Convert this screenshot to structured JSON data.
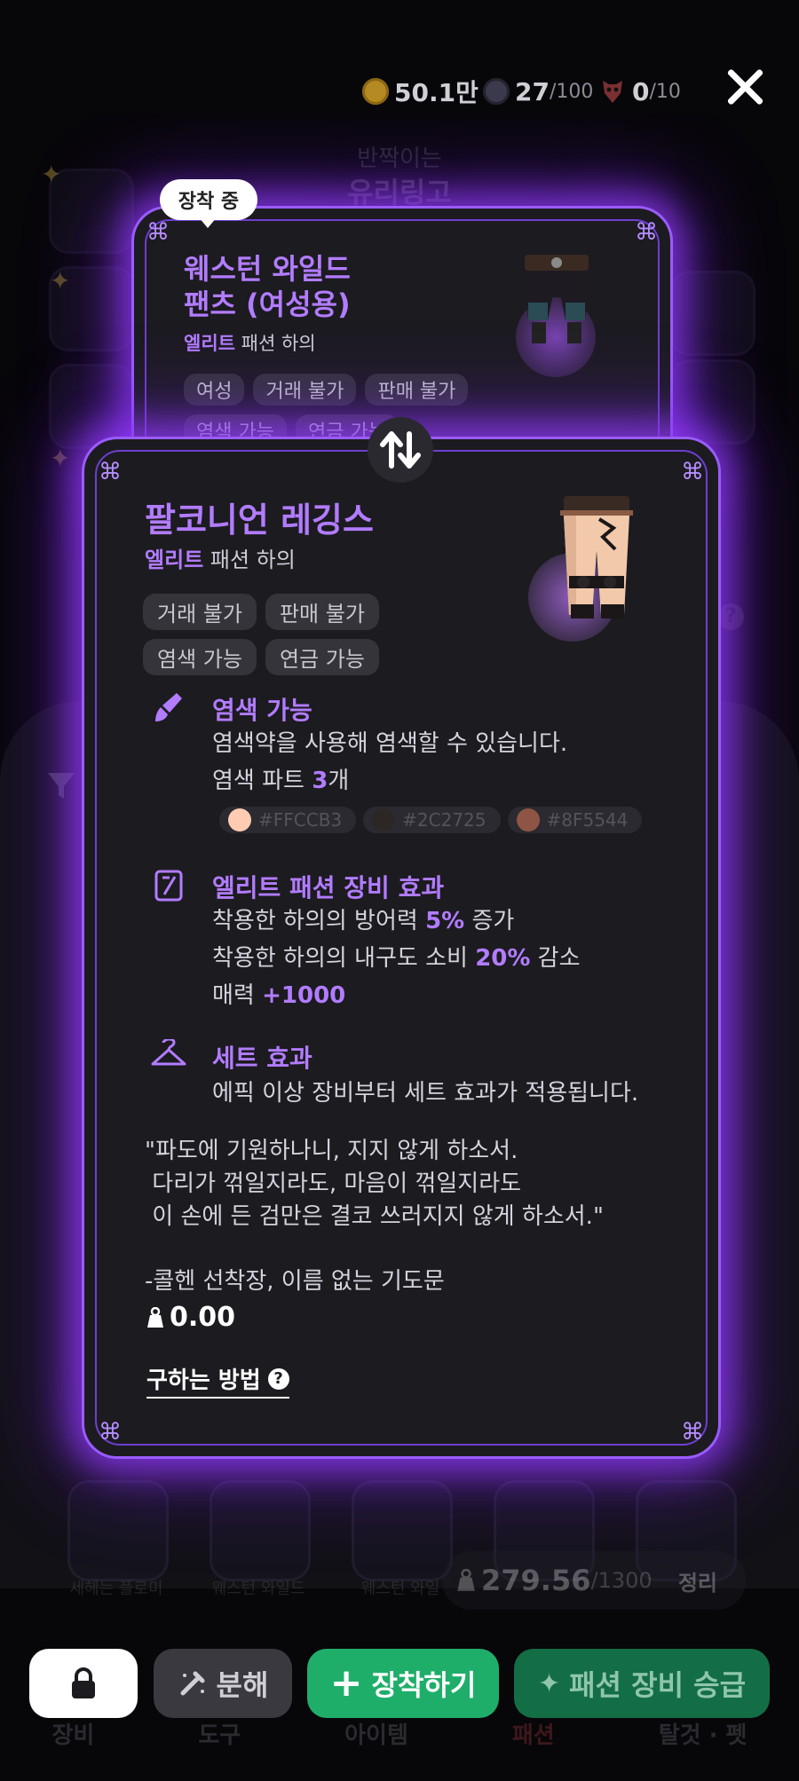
{
  "topbar": {
    "gold": "50.1만",
    "orb_count": "27",
    "orb_max": "/100",
    "mask_count": "0",
    "mask_max": "/10"
  },
  "shop": {
    "subtitle": "반짝이는",
    "title": "유리링고"
  },
  "equipped_card": {
    "badge": "장착 중",
    "name_line1": "웨스턴 와일드",
    "name_line2": "팬츠 (여성용)",
    "grade": "엘리트",
    "type": "패션 하의",
    "tags": [
      "여성",
      "거래 불가",
      "판매 불가",
      "염색 가능",
      "연금 가능"
    ]
  },
  "item_card": {
    "name": "팔코니언 레깅스",
    "grade": "엘리트",
    "type": "패션 하의",
    "tags": [
      "거래 불가",
      "판매 불가",
      "염색 가능",
      "연금 가능"
    ],
    "dye": {
      "title": "염색 가능",
      "desc": "염색약을 사용해 염색할 수 있습니다.",
      "parts_prefix": "염색 파트 ",
      "parts_count": "3",
      "parts_suffix": "개",
      "colors": [
        {
          "hex": "#FFCCB3",
          "swatch": "#FFCCB3"
        },
        {
          "hex": "#2C2725",
          "swatch": "#2C2725"
        },
        {
          "hex": "#8F5544",
          "swatch": "#8F5544"
        }
      ]
    },
    "elite_effect": {
      "title": "엘리트 패션 장비 효과",
      "line1_prefix": "착용한 하의의 방어력 ",
      "line1_value": "5%",
      "line1_suffix": " 증가",
      "line2_prefix": "착용한 하의의 내구도 소비 ",
      "line2_value": "20%",
      "line2_suffix": " 감소",
      "line3_prefix": "매력 ",
      "line3_value": "+1000"
    },
    "set_effect": {
      "title": "세트 효과",
      "desc": "에픽 이상 장비부터 세트 효과가 적용됩니다."
    },
    "quote": "\"파도에 기원하나니, 지지 않게 하소서.\n 다리가 꺾일지라도, 마음이 꺾일지라도\n 이 손에 든 검만은 결코 쓰러지지 않게 하소서.\"",
    "quote_source": "-콜헨 선착장, 이름 없는 기도문",
    "weight": "0.00",
    "how_to_get": "구하는 방법"
  },
  "background": {
    "slot_labels": [
      "세헤는 플로미",
      "웨스턴 와일드",
      "웨스턴 와일"
    ],
    "tab_labels": [
      "장비",
      "도구",
      "아이템",
      "패션",
      "탈것 · 펫"
    ]
  },
  "inventory": {
    "weight": "279.56",
    "weight_max": "/1300",
    "sort_label": "정리"
  },
  "buttons": {
    "lock": "lock",
    "disassemble": "분해",
    "equip": "장착하기",
    "upgrade": "패션 장비 승급"
  },
  "colors": {
    "accent_purple": "#b27cff",
    "glow": "#9a5cff",
    "equip_green": "#1fae6a",
    "upgrade_green": "#146e45"
  }
}
